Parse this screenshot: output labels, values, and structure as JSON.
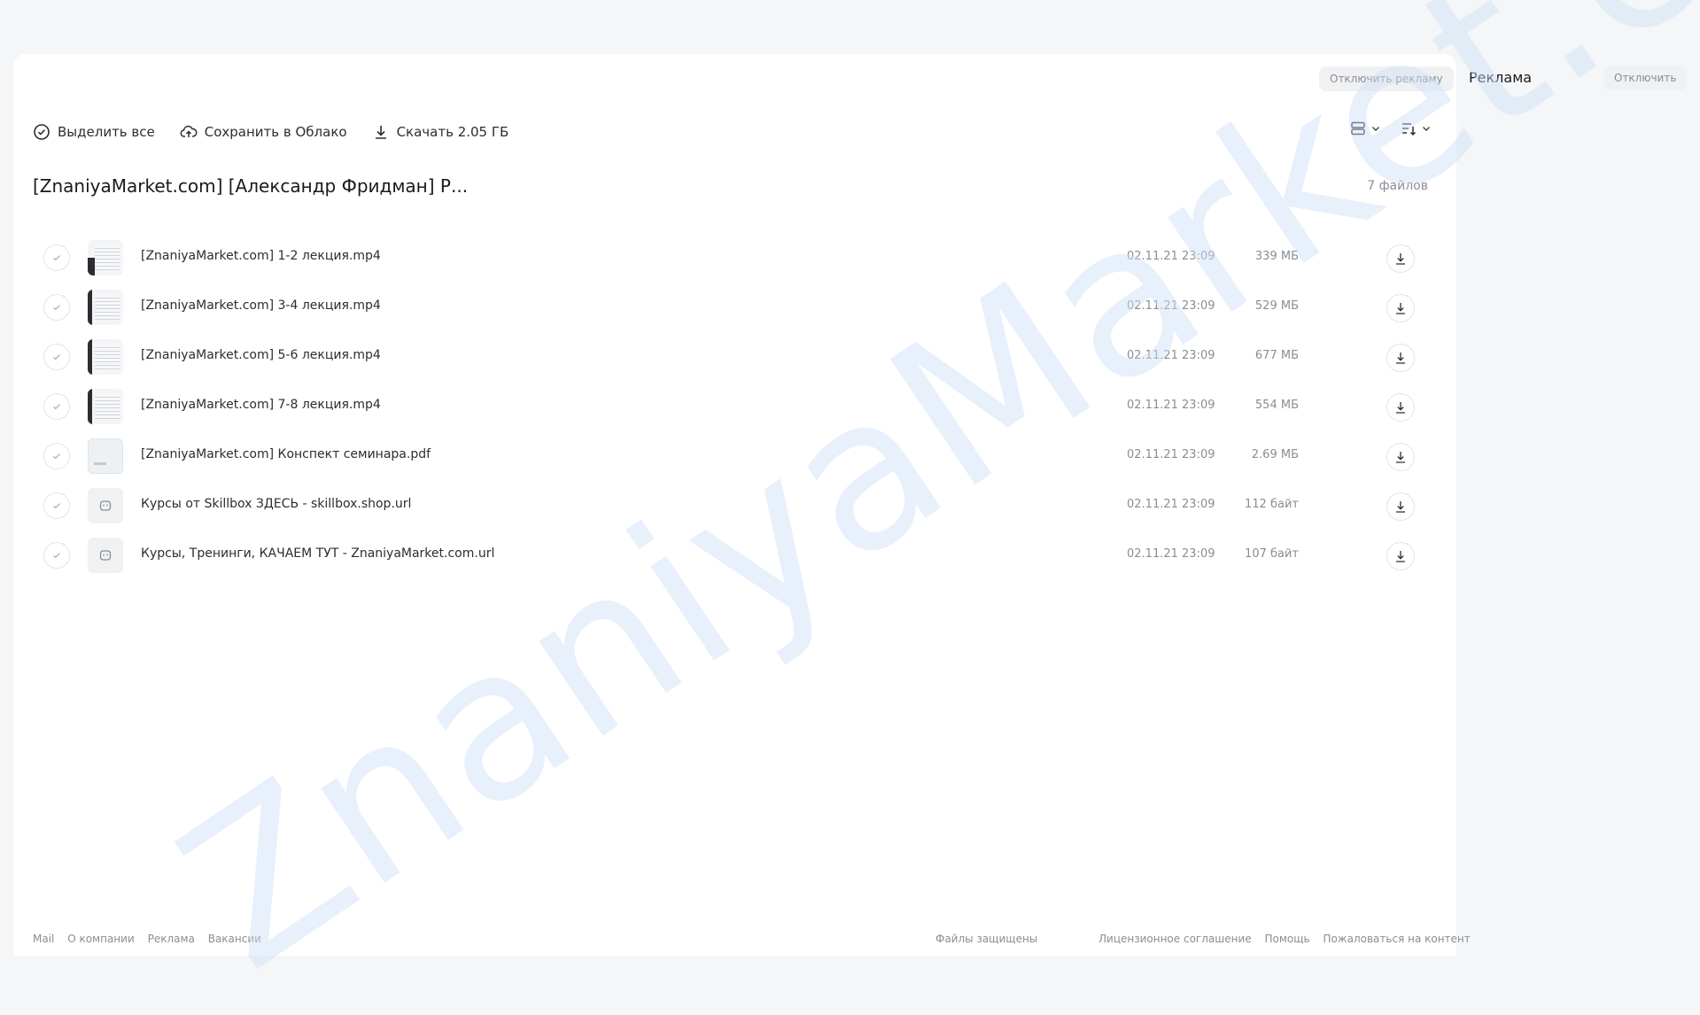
{
  "toolbar": {
    "select_all": "Выделить все",
    "save_cloud": "Сохранить в Облако",
    "download": "Скачать 2.05 ГБ"
  },
  "ad_off_label": "Отключить рекламу",
  "folder": {
    "title": "[ZnaniyaMarket.com] [Александр Фридман] Р...",
    "count": "7 файлов"
  },
  "files": [
    {
      "name": "[ZnaniyaMarket.com] 1-2 лекция.mp4",
      "date": "02.11.21 23:09",
      "size": "339 МБ",
      "icon": "video-thumbnail"
    },
    {
      "name": "[ZnaniyaMarket.com] 3-4 лекция.mp4",
      "date": "02.11.21 23:09",
      "size": "529 МБ",
      "icon": "video-thumbnail"
    },
    {
      "name": "[ZnaniyaMarket.com] 5-6 лекция.mp4",
      "date": "02.11.21 23:09",
      "size": "677 МБ",
      "icon": "video-thumbnail"
    },
    {
      "name": "[ZnaniyaMarket.com] 7-8 лекция.mp4",
      "date": "02.11.21 23:09",
      "size": "554 МБ",
      "icon": "video-thumbnail"
    },
    {
      "name": "[ZnaniyaMarket.com] Конспект семинара.pdf",
      "date": "02.11.21 23:09",
      "size": "2.69 МБ",
      "icon": "pdf-thumbnail"
    },
    {
      "name": "Курсы от Skillbox ЗДЕСЬ - skillbox.shop.url",
      "date": "02.11.21 23:09",
      "size": "112 байт",
      "icon": "link-icon"
    },
    {
      "name": "Курсы, Тренинги, КАЧАЕМ ТУТ - ZnaniyaMarket.com.url",
      "date": "02.11.21 23:09",
      "size": "107 байт",
      "icon": "link-icon"
    }
  ],
  "footer": {
    "left": [
      "Mail",
      "О компании",
      "Реклама",
      "Вакансии"
    ],
    "center": "Файлы защищены",
    "right": [
      "Лицензионное соглашение",
      "Помощь",
      "Пожаловаться на контент"
    ]
  },
  "sidebar": {
    "ad_title": "Реклама",
    "disable_label": "Отключить"
  },
  "watermark": "ZnaniyaMarket.club",
  "colors": {
    "background": "#f5f6f8",
    "panel": "#ffffff",
    "text_primary": "#2c2d2e",
    "text_secondary": "#8b8d90",
    "watermark": "#cde0f7"
  }
}
